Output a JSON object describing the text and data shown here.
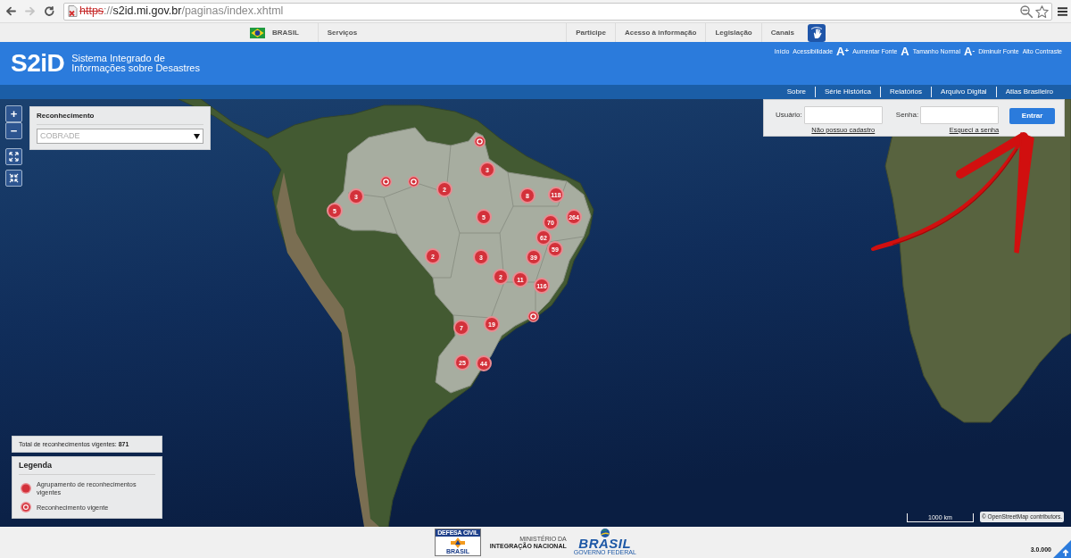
{
  "browser": {
    "nav_buttons": [
      {
        "kind": "back",
        "disabled": false
      },
      {
        "kind": "forward",
        "disabled": true
      },
      {
        "kind": "reload",
        "disabled": false
      }
    ],
    "address": {
      "insecure": true,
      "parts": [
        {
          "kind": "scheme",
          "text": "https"
        },
        {
          "kind": "muted",
          "text": "://"
        },
        {
          "kind": "host",
          "text": "s2id.mi.gov.br"
        },
        {
          "kind": "muted",
          "text": "/paginas/index.xhtml"
        }
      ]
    }
  },
  "gov_bar": {
    "brand": "BRASIL",
    "left_links": [
      "Serviços"
    ],
    "right_links": [
      "Participe",
      "Acesso à informação",
      "Legislação",
      "Canais"
    ]
  },
  "header": {
    "logo": "S2iD",
    "title_lines": [
      "Sistema Integrado de",
      "Informações sobre Desastres"
    ],
    "accessibility_links": [
      {
        "label": "Início"
      },
      {
        "label": "Acessibilidade"
      },
      {
        "glyph": "A$^{+}$",
        "label": "Aumentar Fonte"
      },
      {
        "glyph": "A",
        "label": "Tamanho Normal"
      },
      {
        "glyph": "A$^{-}$",
        "label": "Diminuir Fonte"
      },
      {
        "label": "Alto Contraste"
      }
    ]
  },
  "nav": {
    "links": [
      "Sobre",
      "Série Histórica",
      "Relatórios",
      "Arquivo Digital",
      "Atlas Brasileiro"
    ]
  },
  "map": {
    "zoom_controls": {
      "zoom_in": "+",
      "zoom_out": "−"
    },
    "filter_panel": {
      "title": "Reconhecimento",
      "select": {
        "placeholder": "COBRADE"
      }
    },
    "login": {
      "user_label": "Usuário:",
      "password_label": "Senha:",
      "signup_link": "Não possuo cadastro",
      "forgot_link": "Esqueci a senha",
      "button": "Entrar"
    },
    "markers": [
      {
        "kind": "single"
      },
      {
        "kind": "cluster",
        "count": "3"
      },
      {
        "kind": "single"
      },
      {
        "kind": "single"
      },
      {
        "kind": "cluster",
        "count": "3"
      },
      {
        "kind": "cluster",
        "count": "2"
      },
      {
        "kind": "cluster",
        "count": "8"
      },
      {
        "kind": "cluster",
        "count": "118"
      },
      {
        "kind": "cluster",
        "count": "5"
      },
      {
        "kind": "cluster",
        "count": "5"
      },
      {
        "kind": "cluster",
        "count": "70"
      },
      {
        "kind": "cluster",
        "count": "264"
      },
      {
        "kind": "cluster",
        "count": "62"
      },
      {
        "kind": "cluster",
        "count": "59"
      },
      {
        "kind": "cluster",
        "count": "2"
      },
      {
        "kind": "cluster",
        "count": "3"
      },
      {
        "kind": "cluster",
        "count": "39"
      },
      {
        "kind": "cluster",
        "count": "2"
      },
      {
        "kind": "cluster",
        "count": "11"
      },
      {
        "kind": "cluster",
        "count": "116"
      },
      {
        "kind": "single"
      },
      {
        "kind": "cluster",
        "count": "7"
      },
      {
        "kind": "cluster",
        "count": "19"
      },
      {
        "kind": "cluster",
        "count": "25"
      },
      {
        "kind": "cluster",
        "count": "44"
      }
    ],
    "total": "Total de reconhecimentos vigentes: **871**",
    "legend": {
      "title": "Legenda",
      "items": [
        {
          "kind": "cluster",
          "label": "Agrupamento de reconhecimentos vigentes"
        },
        {
          "kind": "single",
          "label": "Reconhecimento vigente"
        }
      ]
    },
    "scale": "1000 km",
    "attribution": "© OpenStreetMap contributors."
  },
  "footer": {
    "defesa_civil_logo": {
      "top": "DEFESA CIVIL",
      "bottom": "BRASIL"
    },
    "ministry_lines": [
      "MINISTÉRIO DA",
      "INTEGRAÇÃO NACIONAL"
    ],
    "brand_logo": {
      "word": "BRASIL",
      "tagline": "GOVERNO FEDERAL"
    },
    "version": "3.0.000"
  }
}
